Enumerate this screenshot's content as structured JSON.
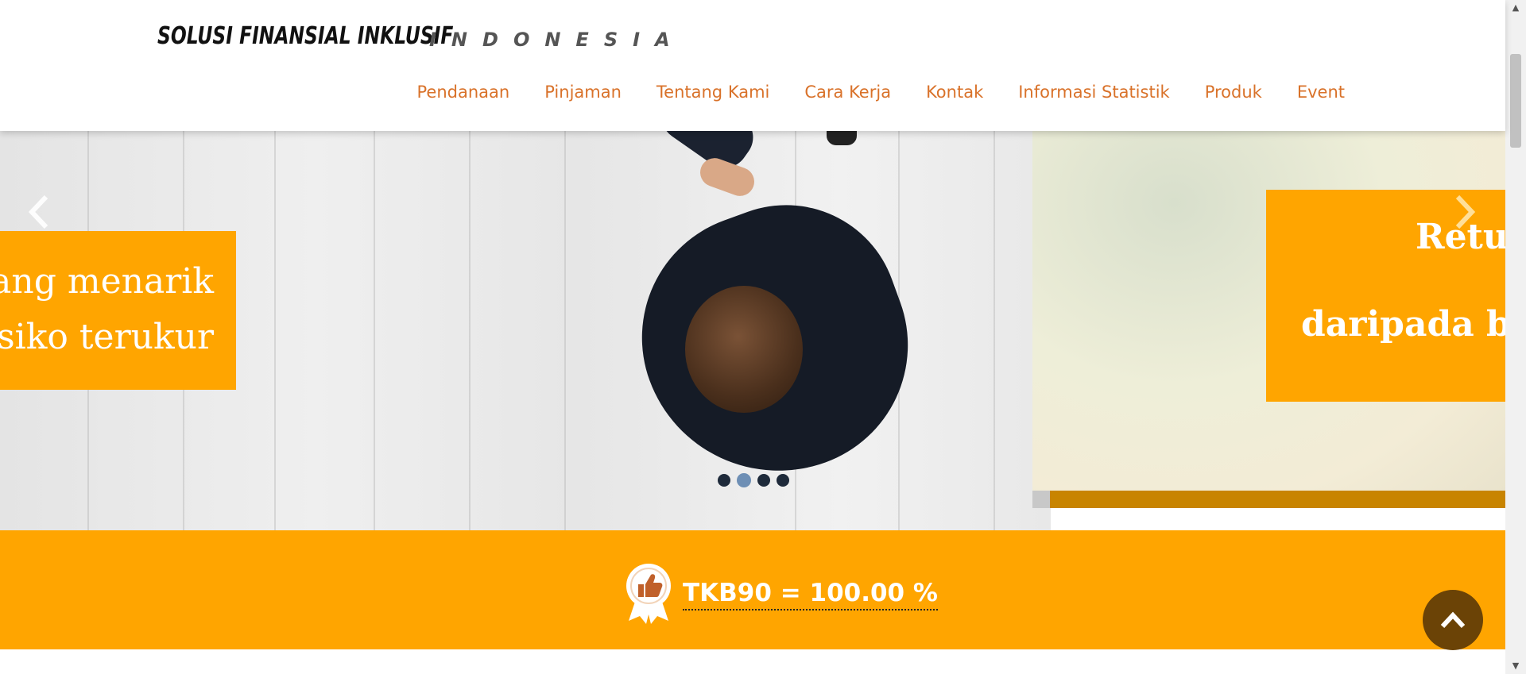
{
  "header": {
    "logo_main": "SOLUSI FINANSIAL INKLUSIF",
    "logo_sub": "INDONESIA",
    "nav": [
      "Pendanaan",
      "Pinjaman",
      "Tentang Kami",
      "Cara Kerja",
      "Kontak",
      "Informasi Statistik",
      "Produk",
      "Event"
    ]
  },
  "slider": {
    "left_caption": [
      "yang menarik",
      "risiko terukur"
    ],
    "right_caption": [
      "Retur",
      "daripada bu"
    ],
    "prev_icon": "chevron-left-icon",
    "next_icon": "chevron-right-icon",
    "dots_count": 4,
    "active_dot": 1,
    "caption_color": "#ffa500"
  },
  "tkb": {
    "label": "TKB90 = 100.00 %",
    "icon": "thumbs-up-badge-icon",
    "band_color": "#ffa500"
  },
  "back_to_top": {
    "icon": "chevron-up-icon",
    "color": "#6b4306"
  },
  "colors": {
    "nav_link": "#d9722a",
    "accent": "#ffa500"
  }
}
